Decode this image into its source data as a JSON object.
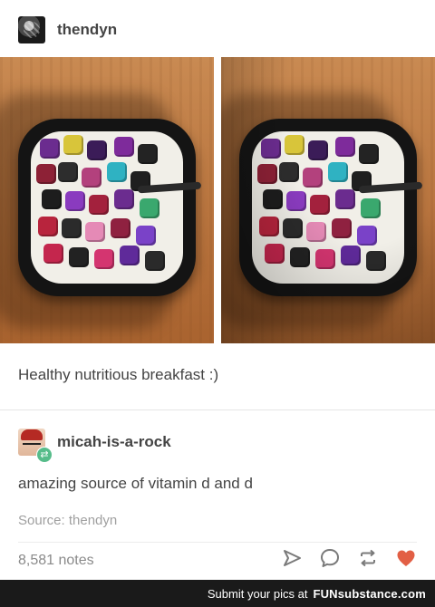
{
  "post": {
    "author": "thendyn",
    "caption": "Healthy nutritious breakfast :)"
  },
  "reblog": {
    "author": "micah-is-a-rock",
    "comment": "amazing source of vitamin d and d",
    "source": "Source: thendyn"
  },
  "footer": {
    "notes": "8,581 notes"
  },
  "watermark": {
    "text": "Submit your pics at",
    "brand": "FUNsubstance.com"
  },
  "colors": {
    "like_heart": "#e25f45",
    "reblog_badge": "#56bc8a",
    "icon_gray": "#7a7a7a"
  },
  "icons": {
    "share": "paper-plane-icon",
    "reply": "speech-bubble-icon",
    "reblog": "reblog-arrows-icon",
    "like": "heart-icon"
  }
}
